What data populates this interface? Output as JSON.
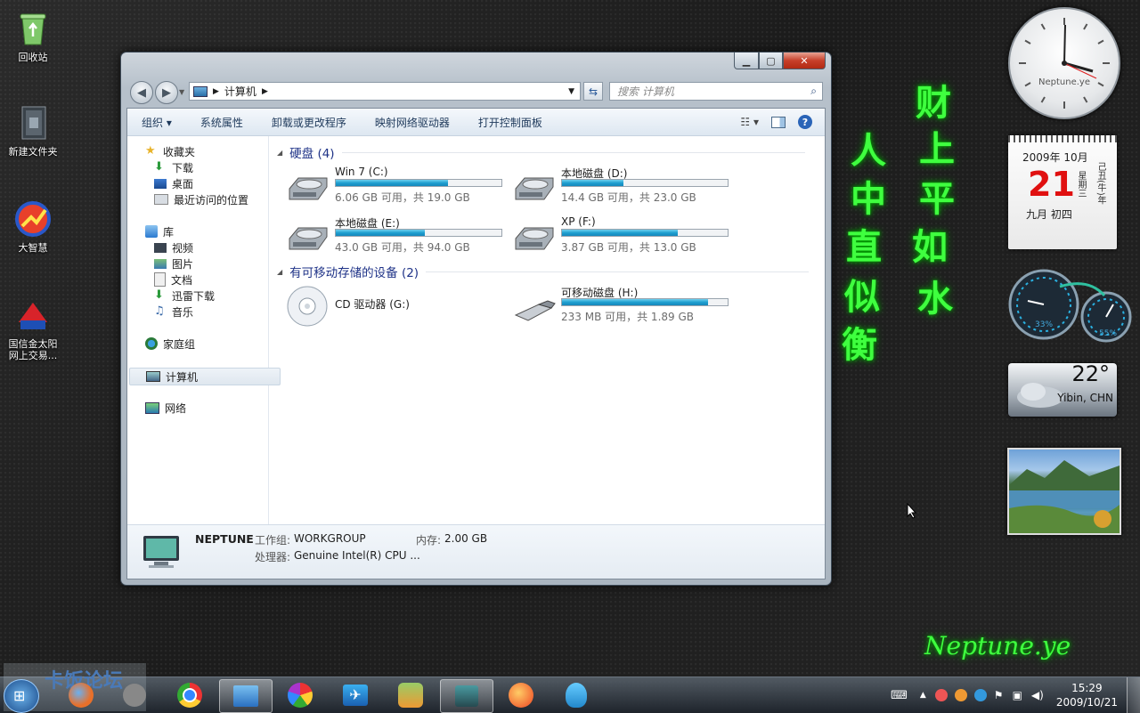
{
  "desktop": {
    "icons": [
      {
        "label": "回收站"
      },
      {
        "label": "新建文件夹"
      },
      {
        "label": "大智慧"
      },
      {
        "label": "国信金太阳\n网上交易..."
      }
    ],
    "neon_text": [
      "财",
      "上",
      "平",
      "如",
      "水",
      "人",
      "中",
      "直",
      "似",
      "衡"
    ],
    "signature": "Neptune.ye"
  },
  "gadgets": {
    "clock_label": "Neptune.ye",
    "calendar": {
      "month": "2009年 10月",
      "day": "21",
      "weekday": "星期三",
      "lunar": "九月 初四",
      "ganzhi": "己丑(牛)年"
    },
    "meter": {
      "cpu": "33%",
      "mem": "55%"
    },
    "weather": {
      "temp": "22°",
      "location": "Yibin, CHN"
    }
  },
  "window": {
    "breadcrumb": "计算机",
    "search_placeholder": "搜索 计算机",
    "toolbar": [
      "组织",
      "系统属性",
      "卸载或更改程序",
      "映射网络驱动器",
      "打开控制面板"
    ],
    "nav": {
      "favorites": "收藏夹",
      "favorites_items": [
        "下载",
        "桌面",
        "最近访问的位置"
      ],
      "library": "库",
      "library_items": [
        "视频",
        "图片",
        "文档",
        "迅雷下载",
        "音乐"
      ],
      "homegroup": "家庭组",
      "computer": "计算机",
      "network": "网络"
    },
    "groups": {
      "hdd": "硬盘 (4)",
      "removable": "有可移动存储的设备 (2)"
    },
    "drives": [
      {
        "name": "Win 7 (C:)",
        "info": "6.06 GB 可用，共 19.0 GB",
        "used_fraction": 0.68
      },
      {
        "name": "本地磁盘 (D:)",
        "info": "14.4 GB 可用，共 23.0 GB",
        "used_fraction": 0.37
      },
      {
        "name": "本地磁盘 (E:)",
        "info": "43.0 GB 可用，共 94.0 GB",
        "used_fraction": 0.54
      },
      {
        "name": "XP (F:)",
        "info": "3.87 GB 可用，共 13.0 GB",
        "used_fraction": 0.7
      }
    ],
    "removable": [
      {
        "name": "CD 驱动器 (G:)"
      },
      {
        "name": "可移动磁盘 (H:)",
        "info": "233 MB 可用，共 1.89 GB",
        "used_fraction": 0.88
      }
    ],
    "details": {
      "computer_name": "NEPTUNE",
      "workgroup_label": "工作组:",
      "workgroup": "WORKGROUP",
      "memory_label": "内存:",
      "memory": "2.00 GB",
      "cpu_label": "处理器:",
      "cpu": "Genuine Intel(R) CPU ..."
    }
  },
  "taskbar": {
    "time": "15:29",
    "date": "2009/10/21",
    "watermark": "卡饭论坛"
  }
}
